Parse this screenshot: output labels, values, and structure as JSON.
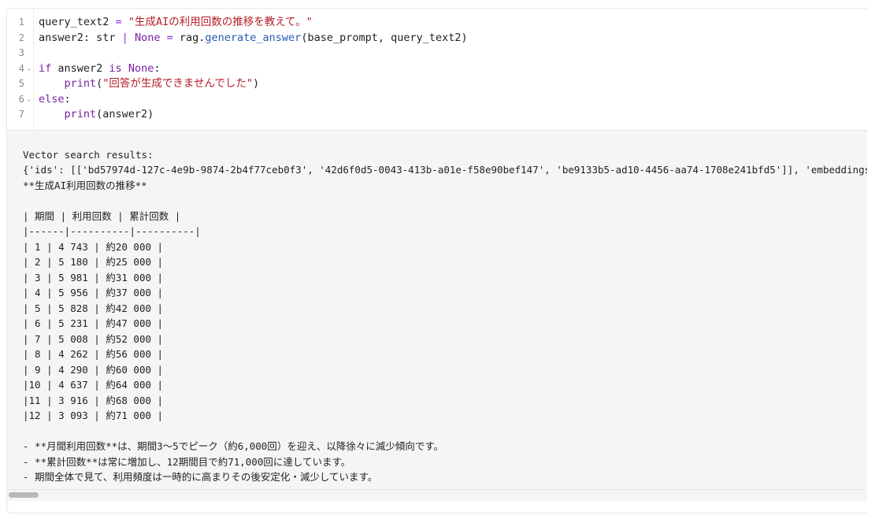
{
  "editor": {
    "lines": [
      {
        "n": "1",
        "fold": "",
        "tokens": [
          {
            "t": "query_text2 ",
            "c": ""
          },
          {
            "t": "=",
            "c": "op"
          },
          {
            "t": " ",
            "c": ""
          },
          {
            "t": "\"生成AIの利用回数の推移を教えて。\"",
            "c": "str"
          }
        ]
      },
      {
        "n": "2",
        "fold": "",
        "tokens": [
          {
            "t": "answer2: str ",
            "c": ""
          },
          {
            "t": "|",
            "c": "op"
          },
          {
            "t": " ",
            "c": ""
          },
          {
            "t": "None",
            "c": "const"
          },
          {
            "t": " ",
            "c": ""
          },
          {
            "t": "=",
            "c": "op"
          },
          {
            "t": " rag.",
            "c": ""
          },
          {
            "t": "generate_answer",
            "c": "fn"
          },
          {
            "t": "(base_prompt, query_text2)",
            "c": ""
          }
        ]
      },
      {
        "n": "3",
        "fold": "",
        "tokens": []
      },
      {
        "n": "4",
        "fold": "⌄",
        "tokens": [
          {
            "t": "if",
            "c": "kw"
          },
          {
            "t": " answer2 ",
            "c": ""
          },
          {
            "t": "is",
            "c": "kw"
          },
          {
            "t": " ",
            "c": ""
          },
          {
            "t": "None",
            "c": "const"
          },
          {
            "t": ":",
            "c": ""
          }
        ]
      },
      {
        "n": "5",
        "fold": "",
        "tokens": [
          {
            "t": "    ",
            "c": ""
          },
          {
            "t": "print",
            "c": "kw"
          },
          {
            "t": "(",
            "c": ""
          },
          {
            "t": "\"回答が生成できませんでした\"",
            "c": "str"
          },
          {
            "t": ")",
            "c": ""
          }
        ]
      },
      {
        "n": "6",
        "fold": "⌄",
        "tokens": [
          {
            "t": "else",
            "c": "kw"
          },
          {
            "t": ":",
            "c": ""
          }
        ]
      },
      {
        "n": "7",
        "fold": "",
        "tokens": [
          {
            "t": "    ",
            "c": ""
          },
          {
            "t": "print",
            "c": "kw"
          },
          {
            "t": "(answer2)",
            "c": ""
          }
        ]
      }
    ]
  },
  "output": {
    "lines": [
      "",
      "Vector search results:",
      "{'ids': [['bd57974d-127c-4e9b-9874-2b4f77ceb0f3', '42d6f0d5-0043-413b-a01e-f58e90bef147', 'be9133b5-ad10-4456-aa74-1708e241bfd5']], 'embeddings': None, 'documents': [['...']]}",
      "**生成AI利用回数の推移**",
      "",
      "| 期間 | 利用回数 | 累計回数 |",
      "|------|----------|----------|",
      "| 1 | 4 743 | 約20 000 |",
      "| 2 | 5 180 | 約25 000 |",
      "| 3 | 5 981 | 約31 000 |",
      "| 4 | 5 956 | 約37 000 |",
      "| 5 | 5 828 | 約42 000 |",
      "| 6 | 5 231 | 約47 000 |",
      "| 7 | 5 008 | 約52 000 |",
      "| 8 | 4 262 | 約56 000 |",
      "| 9 | 4 290 | 約60 000 |",
      "|10 | 4 637 | 約64 000 |",
      "|11 | 3 916 | 約68 000 |",
      "|12 | 3 093 | 約71 000 |",
      "",
      "- **月間利用回数**は、期間3〜5でピーク（約6,000回）を迎え、以降徐々に減少傾向です。",
      "- **累計回数**は常に増加し、12期間目で約71,000回に達しています。",
      "- 期間全体で見て、利用頻度は一時的に高まりその後安定化・減少しています。"
    ]
  },
  "colors": {
    "keyword": "#7a1fa2",
    "string": "#b31d28",
    "function": "#2458b3",
    "output_bg": "#f5f5f5"
  }
}
